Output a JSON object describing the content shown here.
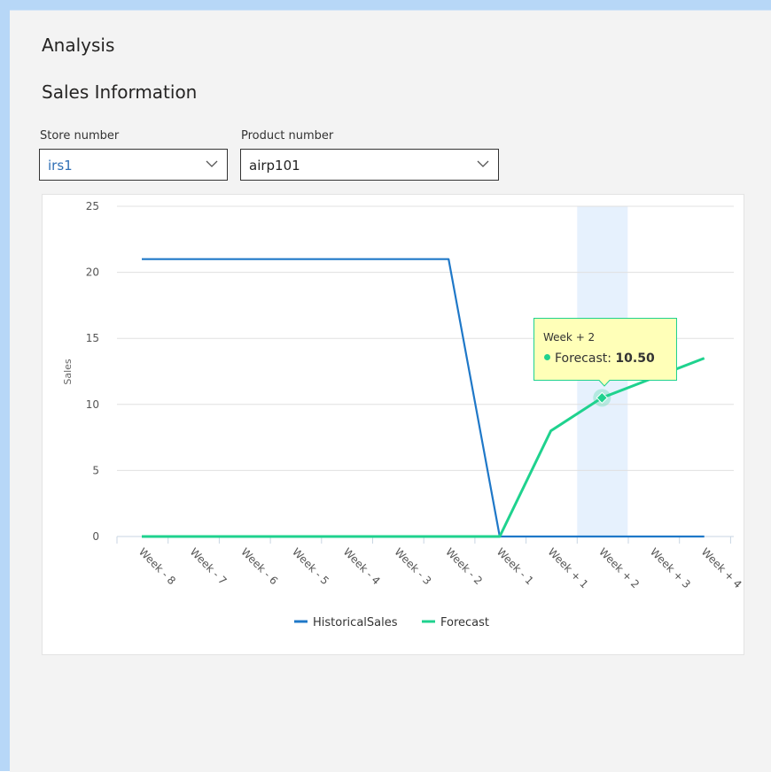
{
  "header": {
    "title": "Analysis",
    "section_title": "Sales Information"
  },
  "filters": {
    "store": {
      "label": "Store number",
      "value": "irs1"
    },
    "product": {
      "label": "Product number",
      "value": "airp101"
    }
  },
  "tooltip": {
    "title": "Week + 2",
    "series": "Forecast",
    "value": "10.50"
  },
  "colors": {
    "historical": "#1f78c8",
    "forecast": "#1fd28e",
    "highlight": "#e6f1fd",
    "tooltip_bg": "#ffffb8",
    "tooltip_border": "#1fd28e"
  },
  "chart_data": {
    "type": "line",
    "ylabel": "Sales",
    "xlabel": "",
    "ylim": [
      0,
      25
    ],
    "yticks": [
      0,
      5,
      10,
      15,
      20,
      25
    ],
    "grid": true,
    "legend_position": "bottom-center",
    "highlighted_category": "Week + 2",
    "categories": [
      "Week - 8",
      "Week - 7",
      "Week - 6",
      "Week - 5",
      "Week - 4",
      "Week - 3",
      "Week - 2",
      "Week - 1",
      "Week + 1",
      "Week + 2",
      "Week + 3",
      "Week + 4"
    ],
    "series": [
      {
        "name": "HistoricalSales",
        "values": [
          21,
          21,
          21,
          21,
          21,
          21,
          21,
          0,
          0,
          0,
          0,
          0
        ]
      },
      {
        "name": "Forecast",
        "values": [
          0,
          0,
          0,
          0,
          0,
          0,
          0,
          0,
          8,
          10.5,
          12,
          13.5
        ]
      }
    ]
  }
}
